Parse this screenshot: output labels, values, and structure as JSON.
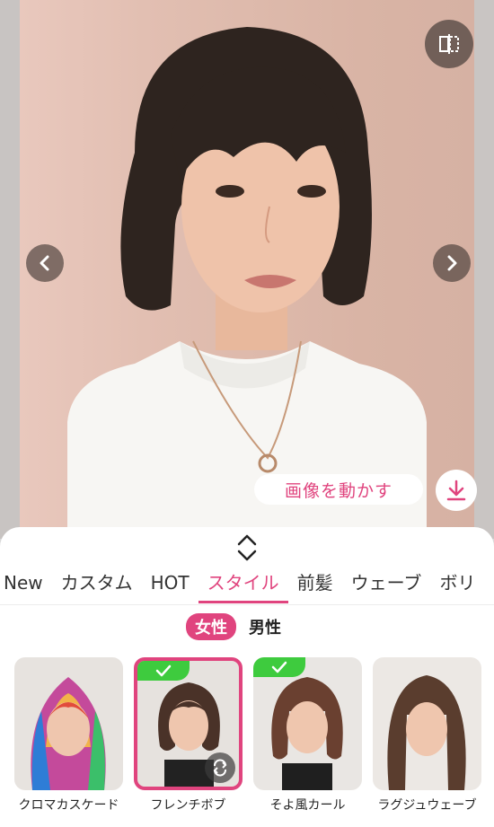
{
  "photo": {
    "description_icon": "portrait-photo"
  },
  "buttons": {
    "compare_icon": "compare-icon",
    "prev_icon": "chevron-left-icon",
    "next_icon": "chevron-right-icon",
    "move_image_label": "画像を動かす",
    "download_icon": "download-icon"
  },
  "panel": {
    "handle_icon": "expand-collapse-icon",
    "tabs": [
      "New",
      "カスタム",
      "HOT",
      "スタイル",
      "前髪",
      "ウェーブ",
      "ボリ"
    ],
    "active_tab": "スタイル",
    "gender": {
      "selected": "女性",
      "other": "男性"
    },
    "cards": [
      {
        "label": "クロマカスケード",
        "selected": false,
        "checked": false
      },
      {
        "label": "フレンチボブ",
        "selected": true,
        "checked": true
      },
      {
        "label": "そよ風カール",
        "selected": false,
        "checked": true
      },
      {
        "label": "ラグジュウェーブ",
        "selected": false,
        "checked": false
      }
    ]
  },
  "colors": {
    "accent": "#e0447e",
    "check": "#3ecb3e"
  }
}
